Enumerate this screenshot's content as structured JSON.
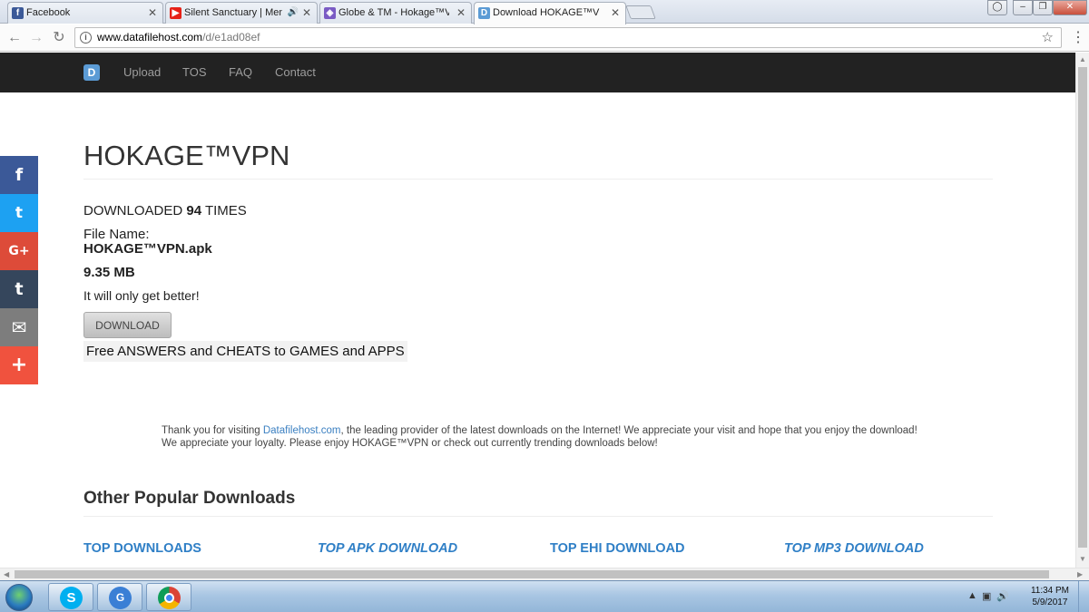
{
  "tabs": [
    {
      "title": "Facebook",
      "icon": "facebook-icon",
      "color": "#3b5998"
    },
    {
      "title": "Silent Sanctuary | Men",
      "icon": "youtube-icon",
      "color": "#e62117"
    },
    {
      "title": "Globe & TM - Hokage™V",
      "icon": "globe-icon",
      "color": "#7a5bc4"
    },
    {
      "title": "Download HOKAGE™VPN",
      "icon": "datafilehost-icon",
      "color": "#5b9bd5"
    }
  ],
  "address": {
    "host": "www.datafilehost.com",
    "path": "/d/e1ad08ef"
  },
  "site_nav": {
    "logo": "D",
    "links": [
      "Upload",
      "TOS",
      "FAQ",
      "Contact"
    ]
  },
  "page": {
    "title": "HOKAGE™VPN",
    "downloaded_prefix": "DOWNLOADED",
    "download_count": "94",
    "downloaded_suffix": "TIMES",
    "file_name_label": "File Name:",
    "file_name": "HOKAGE™VPN.apk",
    "file_size": "9.35 MB",
    "tagline": "It will only get better!",
    "download_button": "DOWNLOAD",
    "promo": "Free ANSWERS and CHEATS to GAMES and APPS",
    "thanks_before": "Thank you for visiting ",
    "thanks_link": "Datafilehost.com",
    "thanks_after": ", the leading provider of the latest downloads on the Internet! We appreciate your visit and hope that you enjoy the download! We appreciate your loyalty. Please enjoy HOKAGE™VPN or check out currently trending downloads below!",
    "other_title": "Other Popular Downloads",
    "top_links": [
      "TOP DOWNLOADS",
      "TOP APK DOWNLOAD",
      "TOP EHI DOWNLOAD",
      "TOP MP3 DOWNLOAD"
    ]
  },
  "share_bar": [
    {
      "icon": "facebook-share-icon",
      "glyph": "f",
      "color": "#3b5998"
    },
    {
      "icon": "twitter-share-icon",
      "glyph": "t",
      "color": "#1da1f2"
    },
    {
      "icon": "google-plus-share-icon",
      "glyph": "G+",
      "color": "#dd4b39"
    },
    {
      "icon": "tumblr-share-icon",
      "glyph": "t",
      "color": "#35465c"
    },
    {
      "icon": "email-share-icon",
      "glyph": "✉",
      "color": "#7d7d7d"
    },
    {
      "icon": "more-share-icon",
      "glyph": "+",
      "color": "#f0523e"
    }
  ],
  "taskbar": {
    "apps": [
      {
        "icon": "skype-icon",
        "glyph": "S",
        "color": "#00aff0"
      },
      {
        "icon": "globe-tattoo-icon",
        "glyph": "G",
        "color": "#3a7fd5"
      },
      {
        "icon": "chrome-icon",
        "glyph": "",
        "color": "#db4437"
      }
    ],
    "time": "11:34 PM",
    "date": "5/9/2017"
  }
}
